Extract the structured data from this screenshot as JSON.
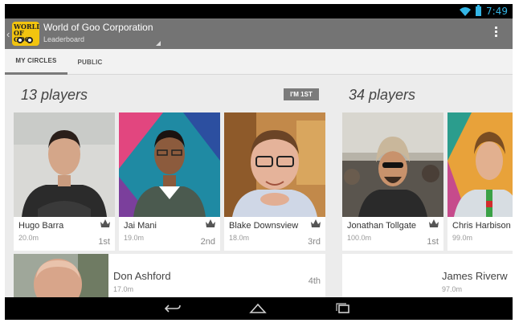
{
  "status_bar": {
    "time": "7:49",
    "icons": [
      "wifi-icon",
      "battery-icon"
    ],
    "accent": "#33b5e5"
  },
  "action_bar": {
    "title": "World of Goo Corporation",
    "subtitle": "Leaderboard",
    "logo_text": "WORLD OF GOO",
    "background": "#747474"
  },
  "tabs": [
    {
      "label": "MY CIRCLES",
      "active": true
    },
    {
      "label": "PUBLIC",
      "active": false
    }
  ],
  "sections": [
    {
      "title": "13 players",
      "badge": "I'M 1ST"
    },
    {
      "title": "34 players"
    }
  ],
  "players_circles": [
    {
      "name": "Hugo Barra",
      "score": "20.0m",
      "rank": "1st"
    },
    {
      "name": "Jai Mani",
      "score": "19.0m",
      "rank": "2nd"
    },
    {
      "name": "Blake Downsview",
      "score": "18.0m",
      "rank": "3rd"
    },
    {
      "name": "Don Ashford",
      "score": "17.0m",
      "rank": "4th"
    }
  ],
  "players_public": [
    {
      "name": "Jonathan Tollgate",
      "score": "100.0m",
      "rank": "1st"
    },
    {
      "name": "Chris Harbison",
      "score": "99.0m"
    },
    {
      "name": "James Riverw",
      "score": "97.0m"
    }
  ],
  "nav_bar": {
    "buttons": [
      "back-icon",
      "home-icon",
      "recents-icon"
    ]
  }
}
